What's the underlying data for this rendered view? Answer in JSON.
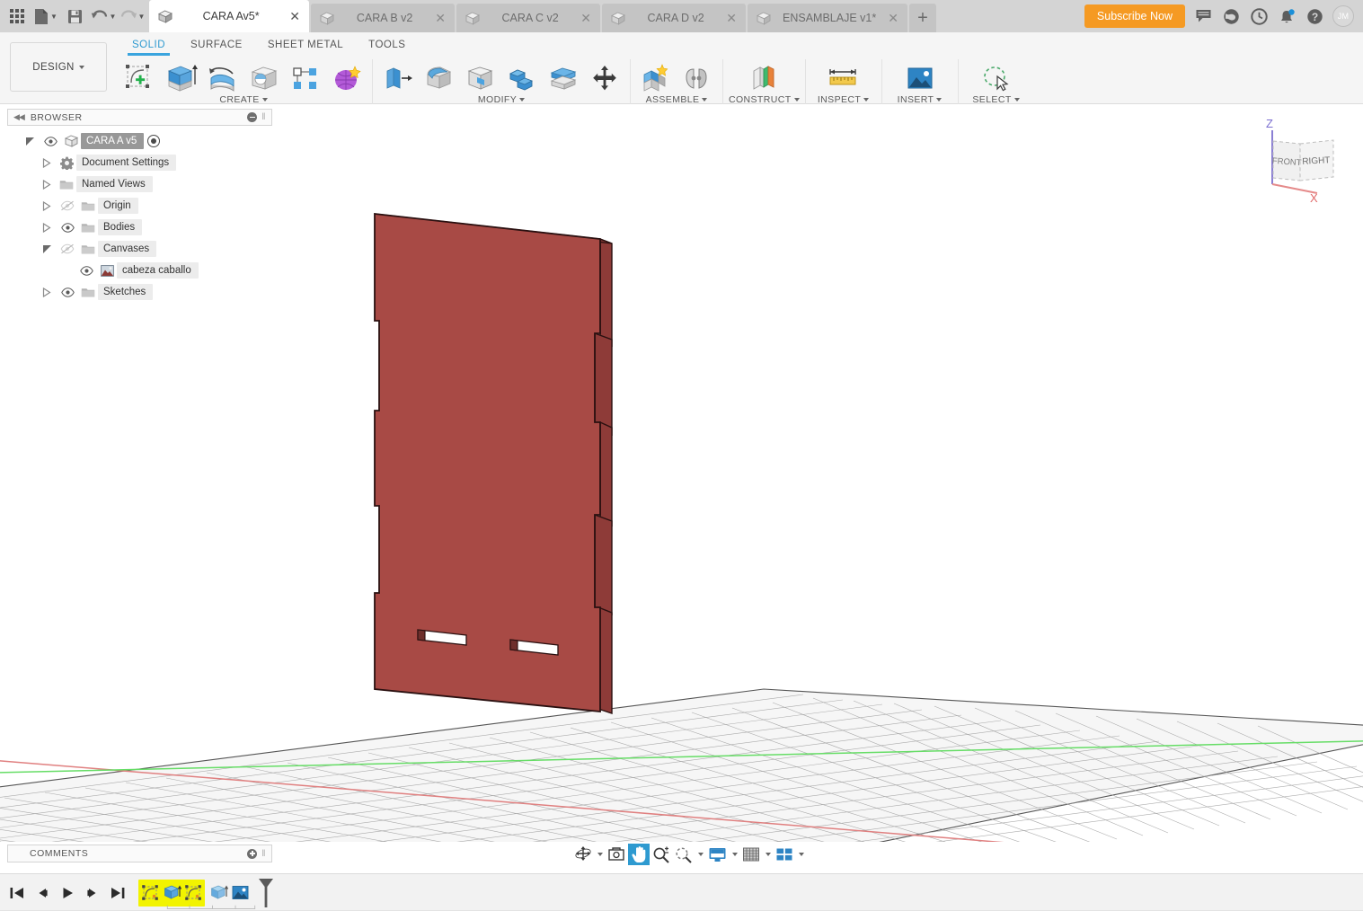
{
  "app": {
    "title": "Autodesk Fusion 360",
    "accent_blue": "#2e9ad0",
    "subscribe_orange": "#f59a23",
    "body_color": "#a84a45",
    "highlight_yellow": "#f2f300"
  },
  "quick_access": {
    "items": [
      {
        "name": "app-grid-icon",
        "label": "Show Data Panel"
      },
      {
        "name": "file-icon",
        "label": "File"
      },
      {
        "name": "save-icon",
        "label": "Save"
      },
      {
        "name": "undo-icon",
        "label": "Undo"
      },
      {
        "name": "redo-icon",
        "label": "Redo"
      }
    ]
  },
  "tabs": [
    {
      "label": "CARA Av5*",
      "active": true,
      "closable": true
    },
    {
      "label": "CARA B v2",
      "active": false,
      "closable": true
    },
    {
      "label": "CARA C v2",
      "active": false,
      "closable": true
    },
    {
      "label": "CARA D v2",
      "active": false,
      "closable": true
    },
    {
      "label": "ENSAMBLAJE v1*",
      "active": false,
      "closable": true
    }
  ],
  "tab_add_label": "+",
  "tab_close_glyph": "✕",
  "topbar_right": {
    "subscribe_label": "Subscribe Now",
    "icons": [
      {
        "name": "comment-icon",
        "label": "Comments"
      },
      {
        "name": "globe-icon",
        "label": "Job Status"
      },
      {
        "name": "clock-icon",
        "label": "Recent"
      },
      {
        "name": "bell-icon",
        "label": "Notifications",
        "badge": true
      },
      {
        "name": "help-icon",
        "label": "Help"
      }
    ],
    "avatar_initials": "JM"
  },
  "ribbon": {
    "design_label": "DESIGN",
    "workspace_tabs": [
      {
        "label": "SOLID",
        "active": true
      },
      {
        "label": "SURFACE",
        "active": false
      },
      {
        "label": "SHEET METAL",
        "active": false
      },
      {
        "label": "TOOLS",
        "active": false
      }
    ],
    "panels": [
      {
        "label": "CREATE",
        "has_dropdown": true,
        "tools": [
          {
            "name": "create-sketch-icon",
            "label": "Create Sketch"
          },
          {
            "name": "extrude-icon",
            "label": "Extrude"
          },
          {
            "name": "revolve-icon",
            "label": "Revolve"
          },
          {
            "name": "sphere-icon",
            "label": "Sphere"
          },
          {
            "name": "pattern-icon",
            "label": "Rectangular Pattern"
          },
          {
            "name": "form-icon",
            "label": "Create Form"
          }
        ]
      },
      {
        "label": "MODIFY",
        "has_dropdown": true,
        "tools": [
          {
            "name": "press-pull-icon",
            "label": "Press Pull"
          },
          {
            "name": "fillet-icon",
            "label": "Fillet"
          },
          {
            "name": "shell-icon",
            "label": "Shell"
          },
          {
            "name": "combine-icon",
            "label": "Combine"
          },
          {
            "name": "split-face-icon",
            "label": "Split Body"
          },
          {
            "name": "move-copy-icon",
            "label": "Move/Copy"
          }
        ]
      },
      {
        "label": "ASSEMBLE",
        "has_dropdown": true,
        "tools": [
          {
            "name": "new-component-icon",
            "label": "New Component"
          },
          {
            "name": "joint-icon",
            "label": "Joint"
          }
        ]
      },
      {
        "label": "CONSTRUCT",
        "has_dropdown": true,
        "tools": [
          {
            "name": "offset-plane-icon",
            "label": "Offset Plane"
          }
        ]
      },
      {
        "label": "INSPECT",
        "has_dropdown": true,
        "tools": [
          {
            "name": "measure-icon",
            "label": "Measure"
          }
        ]
      },
      {
        "label": "INSERT",
        "has_dropdown": true,
        "tools": [
          {
            "name": "insert-image-icon",
            "label": "Canvas"
          }
        ]
      },
      {
        "label": "SELECT",
        "has_dropdown": true,
        "tools": [
          {
            "name": "select-lasso-icon",
            "label": "Select"
          }
        ]
      }
    ]
  },
  "browser": {
    "title": "BROWSER",
    "tree": [
      {
        "label": "CARA  A v5",
        "depth": 0,
        "twist": "open",
        "eye": "visible",
        "icon": "component-icon",
        "selected": true,
        "radio": true
      },
      {
        "label": "Document Settings",
        "depth": 1,
        "twist": "closed",
        "eye": "none",
        "icon": "settings-gear-icon",
        "selected": false,
        "radio": false
      },
      {
        "label": "Named Views",
        "depth": 1,
        "twist": "closed",
        "eye": "none",
        "icon": "folder-icon",
        "selected": false,
        "radio": false
      },
      {
        "label": "Origin",
        "depth": 1,
        "twist": "closed",
        "eye": "hidden",
        "icon": "folder-icon",
        "selected": false,
        "radio": false
      },
      {
        "label": "Bodies",
        "depth": 1,
        "twist": "closed",
        "eye": "visible",
        "icon": "folder-icon",
        "selected": false,
        "radio": false
      },
      {
        "label": "Canvases",
        "depth": 1,
        "twist": "open",
        "eye": "hidden",
        "icon": "folder-icon",
        "selected": false,
        "radio": false
      },
      {
        "label": "cabeza caballo",
        "depth": 2,
        "twist": "none",
        "eye": "visible",
        "icon": "canvas-image-icon",
        "selected": false,
        "radio": false
      },
      {
        "label": "Sketches",
        "depth": 1,
        "twist": "closed",
        "eye": "visible",
        "icon": "folder-icon",
        "selected": false,
        "radio": false
      }
    ]
  },
  "viewcube": {
    "front_label": "FRONT",
    "right_label": "RIGHT",
    "z_label": "Z",
    "x_label": "X"
  },
  "comments": {
    "title": "COMMENTS"
  },
  "navbar": {
    "items": [
      {
        "name": "orbit-icon",
        "label": "Orbit",
        "active": false,
        "dropdown": true
      },
      {
        "name": "look-at-icon",
        "label": "Look At",
        "active": false,
        "dropdown": false
      },
      {
        "name": "pan-icon",
        "label": "Pan",
        "active": true,
        "dropdown": false
      },
      {
        "name": "zoom-icon",
        "label": "Zoom",
        "active": false,
        "dropdown": false
      },
      {
        "name": "zoom-window-icon",
        "label": "Fit",
        "active": false,
        "dropdown": true
      },
      {
        "name": "display-settings-icon",
        "label": "Display Settings",
        "active": false,
        "dropdown": true
      },
      {
        "name": "grid-snaps-icon",
        "label": "Grid and Snaps",
        "active": false,
        "dropdown": true
      },
      {
        "name": "viewports-icon",
        "label": "Viewports",
        "active": false,
        "dropdown": true
      }
    ]
  },
  "timeline": {
    "playback": [
      {
        "name": "timeline-start-icon",
        "label": "Go to beginning"
      },
      {
        "name": "timeline-step-back-icon",
        "label": "Step back"
      },
      {
        "name": "timeline-play-icon",
        "label": "Play"
      },
      {
        "name": "timeline-step-forward-icon",
        "label": "Step forward"
      },
      {
        "name": "timeline-end-icon",
        "label": "Go to end"
      }
    ],
    "features": [
      {
        "name": "sketch-feature-icon",
        "label": "Sketch1",
        "highlighted": true
      },
      {
        "name": "extrude-feature-icon",
        "label": "Extrude1",
        "highlighted": true
      },
      {
        "name": "sketch-feature-icon",
        "label": "Sketch2",
        "highlighted": true
      },
      {
        "name": "extrude-feature-icon",
        "label": "Extrude2",
        "highlighted": false
      },
      {
        "name": "canvas-feature-icon",
        "label": "Canvas1",
        "highlighted": false
      }
    ],
    "marker_name": "timeline-end-marker"
  },
  "model": {
    "name": "CARA A panel",
    "face_color": "#a84a45",
    "edge_color": "#2a1010",
    "slot_color": "#ffffff",
    "description": "Red rectangular plate with tab notches on left and right edges and two horizontal slots near the bottom"
  },
  "grid": {
    "axis_x_color": "#e08080",
    "axis_y_color": "#66dd66",
    "line_color": "#9a9a9a",
    "plane_fill": "#f4f4f4"
  }
}
